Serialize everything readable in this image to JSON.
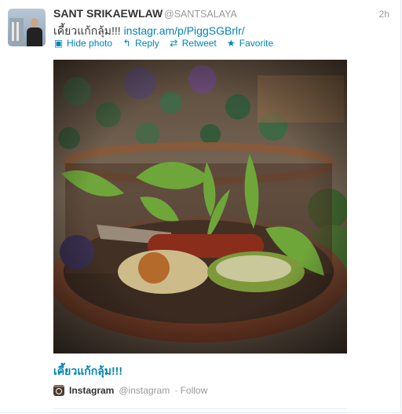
{
  "tweet": {
    "name": "SANT SRIKAEWLAW",
    "handle": "@SANTSALAYA",
    "time": "2h",
    "text_prefix": "เคี้ยวแก้กลุ้ม!!! ",
    "link": "instagr.am/p/PiggSGBrlr/"
  },
  "actions": [
    {
      "icon": "image-icon",
      "label": "Hide photo"
    },
    {
      "icon": "reply-icon",
      "label": "Reply"
    },
    {
      "icon": "retweet-icon",
      "label": "Retweet"
    },
    {
      "icon": "star-icon",
      "label": "Favorite"
    }
  ],
  "media": {
    "caption": "เคี้ยวแก้กลุ้ม!!!",
    "source_name": "Instagram",
    "source_handle": "@instagram",
    "follow_label": "· Follow"
  }
}
